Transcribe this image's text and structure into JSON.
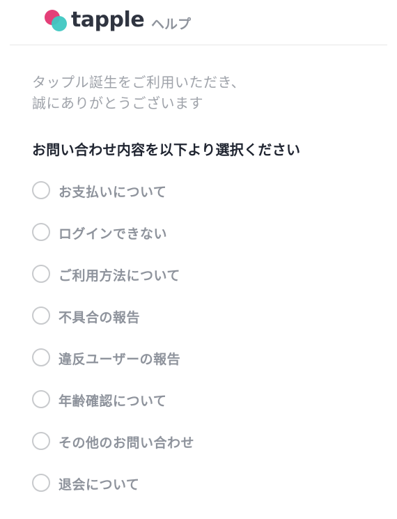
{
  "header": {
    "logo_text": "tapple",
    "help_label": "ヘルプ",
    "colors": {
      "pink": "#e43f78",
      "teal": "#3fc7c2"
    }
  },
  "welcome": {
    "line1": "タップル誕生をご利用いただき、",
    "line2": "誠にありがとうございます"
  },
  "prompt": "お問い合わせ内容を以下より選択ください",
  "options": [
    {
      "label": "お支払いについて",
      "selected": false
    },
    {
      "label": "ログインできない",
      "selected": false
    },
    {
      "label": "ご利用方法について",
      "selected": false
    },
    {
      "label": "不具合の報告",
      "selected": false
    },
    {
      "label": "違反ユーザーの報告",
      "selected": false
    },
    {
      "label": "年齢確認について",
      "selected": false
    },
    {
      "label": "その他のお問い合わせ",
      "selected": false
    },
    {
      "label": "退会について",
      "selected": false
    }
  ]
}
